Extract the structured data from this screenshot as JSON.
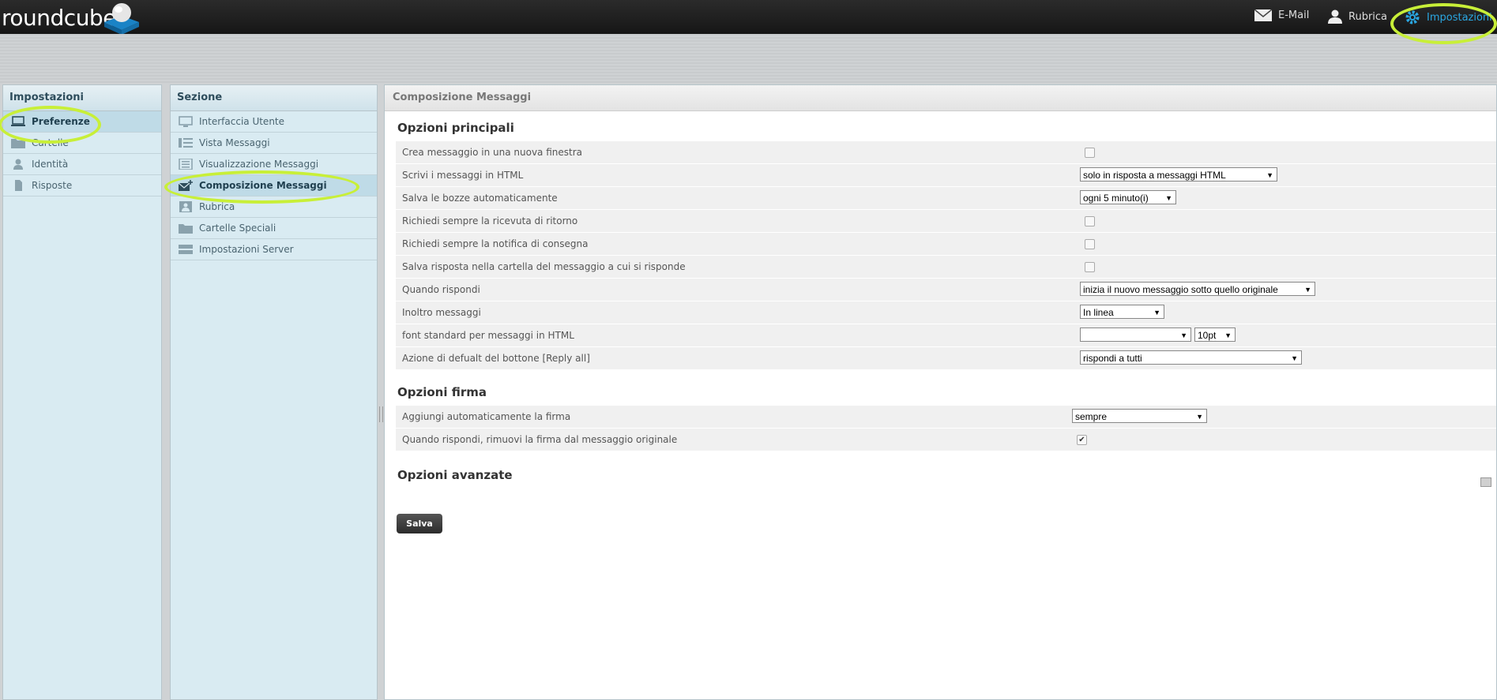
{
  "app": {
    "logo_text": "roundcube"
  },
  "topnav": [
    {
      "label": "E-Mail",
      "icon": "envelope-icon"
    },
    {
      "label": "Rubrica",
      "icon": "person-icon"
    },
    {
      "label": "Impostazioni",
      "icon": "gear-icon",
      "active": true
    }
  ],
  "settings_panel": {
    "title": "Impostazioni",
    "items": [
      {
        "label": "Preferenze",
        "icon": "laptop-icon",
        "selected": true
      },
      {
        "label": "Cartelle",
        "icon": "folder-icon"
      },
      {
        "label": "Identità",
        "icon": "person-icon"
      },
      {
        "label": "Risposte",
        "icon": "document-icon"
      }
    ]
  },
  "section_panel": {
    "title": "Sezione",
    "items": [
      {
        "label": "Interfaccia Utente",
        "icon": "monitor-icon"
      },
      {
        "label": "Vista Messaggi",
        "icon": "list-icon"
      },
      {
        "label": "Visualizzazione Messaggi",
        "icon": "message-view-icon"
      },
      {
        "label": "Composizione Messaggi",
        "icon": "compose-icon",
        "selected": true
      },
      {
        "label": "Rubrica",
        "icon": "contact-icon"
      },
      {
        "label": "Cartelle Speciali",
        "icon": "folder-icon"
      },
      {
        "label": "Impostazioni Server",
        "icon": "server-icon"
      }
    ]
  },
  "main": {
    "title": "Composizione Messaggi",
    "sections": {
      "principali": "Opzioni principali",
      "firma": "Opzioni firma",
      "avanzate": "Opzioni avanzate"
    },
    "rows": {
      "r1": "Crea messaggio in una nuova finestra",
      "r2": "Scrivi i messaggi in HTML",
      "r2_value": "solo in risposta a messaggi HTML",
      "r3": "Salva le bozze automaticamente",
      "r3_value": "ogni 5 minuto(i)",
      "r4": "Richiedi sempre la ricevuta di ritorno",
      "r5": "Richiedi sempre la notifica di consegna",
      "r6": "Salva risposta nella cartella del messaggio a cui si risponde",
      "r7": "Quando rispondi",
      "r7_value": "inizia il nuovo messaggio sotto quello originale",
      "r8": "Inoltro messaggi",
      "r8_value": "In linea",
      "r9": "font standard per messaggi in HTML",
      "r9_font_value": "",
      "r9_size_value": "10pt",
      "r10": "Azione di defualt del bottone [Reply all]",
      "r10_value": "rispondi a tutti",
      "s1": "Aggiungi automaticamente la firma",
      "s1_value": "sempre",
      "s2": "Quando rispondi, rimuovi la firma dal messaggio originale"
    },
    "save_label": "Salva"
  },
  "colors": {
    "highlight_ring": "#c8ef38",
    "active_nav": "#2aa7e2"
  }
}
